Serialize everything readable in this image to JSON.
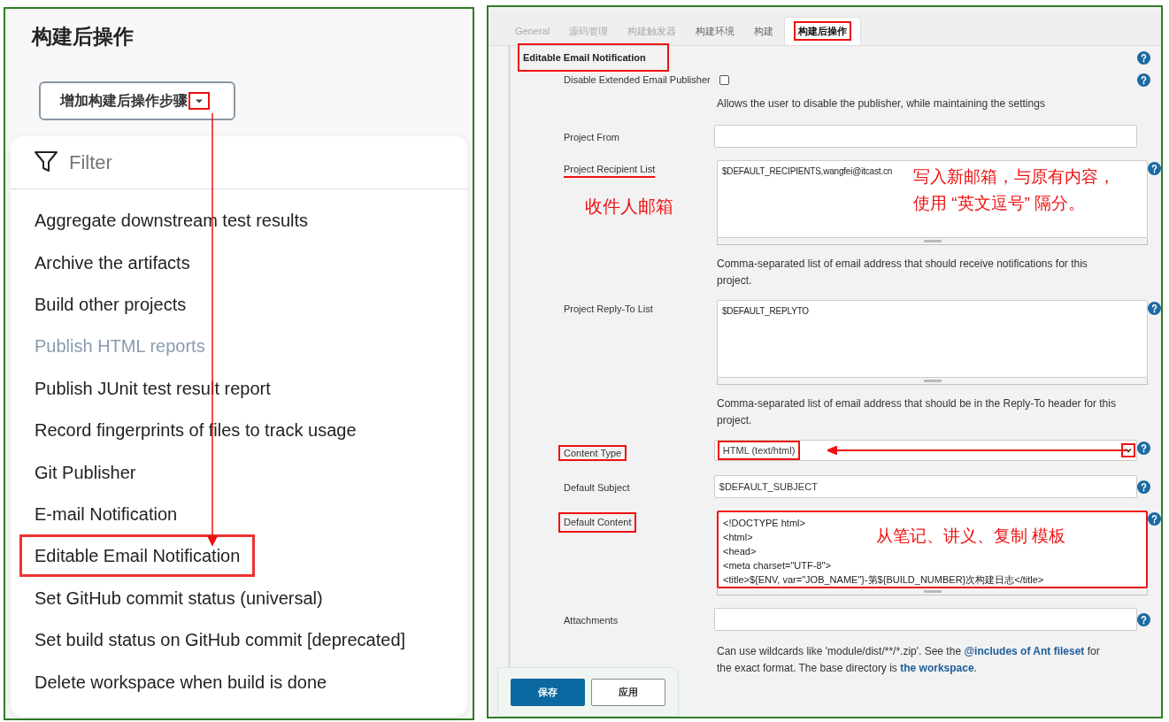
{
  "left": {
    "heading": "构建后操作",
    "add_button": {
      "label": "增加构建后操作步骤",
      "caret_annotated": true
    },
    "filter": {
      "placeholder": "Filter"
    },
    "menu_items": [
      {
        "label": "Aggregate downstream test results",
        "dimmed": false,
        "annotated": false
      },
      {
        "label": "Archive the artifacts",
        "dimmed": false,
        "annotated": false
      },
      {
        "label": "Build other projects",
        "dimmed": false,
        "annotated": false
      },
      {
        "label": "Publish HTML reports",
        "dimmed": true,
        "annotated": false
      },
      {
        "label": "Publish JUnit test result report",
        "dimmed": false,
        "annotated": false
      },
      {
        "label": "Record fingerprints of files to track usage",
        "dimmed": false,
        "annotated": false
      },
      {
        "label": "Git Publisher",
        "dimmed": false,
        "annotated": false
      },
      {
        "label": "E-mail Notification",
        "dimmed": false,
        "annotated": false
      },
      {
        "label": "Editable Email Notification",
        "dimmed": false,
        "annotated": true
      },
      {
        "label": "Set GitHub commit status (universal)",
        "dimmed": false,
        "annotated": false
      },
      {
        "label": "Set build status on GitHub commit [deprecated]",
        "dimmed": false,
        "annotated": false
      },
      {
        "label": "Delete workspace when build is done",
        "dimmed": false,
        "annotated": false
      }
    ]
  },
  "right": {
    "tabs": [
      {
        "label": "General",
        "selected": false,
        "faded": true,
        "annotated": false
      },
      {
        "label": "源码管理",
        "selected": false,
        "faded": true,
        "annotated": false
      },
      {
        "label": "构建触发器",
        "selected": false,
        "faded": true,
        "annotated": false
      },
      {
        "label": "构建环境",
        "selected": false,
        "faded": false,
        "annotated": false
      },
      {
        "label": "构建",
        "selected": false,
        "faded": false,
        "annotated": false
      },
      {
        "label": "构建后操作",
        "selected": true,
        "faded": false,
        "annotated": true
      }
    ],
    "section": {
      "title": "Editable Email Notification",
      "annotated": true
    },
    "rows": [
      {
        "kind": "checkbox",
        "label": "Disable Extended Email Publisher",
        "checked": false,
        "help": true
      },
      {
        "kind": "description",
        "text": "Allows the user to disable the publisher, while maintaining the settings"
      },
      {
        "kind": "input",
        "label": "Project From",
        "help": false,
        "label_boxed": false,
        "label_underlined": false
      },
      {
        "kind": "textarea",
        "label": "Project Recipient List",
        "label_boxed": false,
        "label_underlined": true,
        "help": true,
        "lines": [
          "$DEFAULT_RECIPIENTS,wangfei@itcast.cn"
        ],
        "note": "收件人邮箱",
        "overlay_lines": [
          "写入新邮箱，与原有内容，",
          "使用 “英文逗号” 隔分。"
        ],
        "annotated": false
      },
      {
        "kind": "description",
        "text": "Comma-separated list of email address that should receive notifications for this project."
      },
      {
        "kind": "textarea",
        "label": "Project Reply-To List",
        "label_boxed": false,
        "label_underlined": false,
        "help": true,
        "lines": [
          "$DEFAULT_REPLYTO"
        ],
        "annotated": false
      },
      {
        "kind": "description",
        "text": "Comma-separated list of email address that should be in the Reply-To header for this project."
      },
      {
        "kind": "select",
        "label": "Content Type",
        "label_boxed": true,
        "label_underlined": false,
        "help": true,
        "value": "HTML (text/html)",
        "annotated": true
      },
      {
        "kind": "input",
        "label": "Default Subject",
        "help": true,
        "label_boxed": false,
        "label_underlined": false,
        "value": "$DEFAULT_SUBJECT"
      },
      {
        "kind": "textarea",
        "label": "Default Content",
        "label_boxed": true,
        "label_underlined": false,
        "help": true,
        "lines": [
          "<!DOCTYPE html>",
          "<html>",
          "<head>",
          "<meta charset=\"UTF-8\">",
          "<title>${ENV, var=\"JOB_NAME\"}-第${BUILD_NUMBER}次构建日志</title>"
        ],
        "overlay_lines": [
          "从笔记、讲义、复制 模板"
        ],
        "annotated": true
      },
      {
        "kind": "input",
        "label": "Attachments",
        "help": true,
        "label_boxed": false,
        "label_underlined": false
      },
      {
        "kind": "description",
        "parts": [
          {
            "text": "Can use wildcards like 'module/dist/**/*.zip'. See the ",
            "link": false
          },
          {
            "text": "@includes of Ant fileset",
            "link": true
          },
          {
            "text": " for the exact format. The base directory is ",
            "link": false
          },
          {
            "text": "the workspace",
            "link": true
          },
          {
            "text": ".",
            "link": false
          }
        ]
      }
    ],
    "buttons": [
      {
        "label": "保存",
        "primary": true
      },
      {
        "label": "应用",
        "primary": false
      }
    ]
  }
}
